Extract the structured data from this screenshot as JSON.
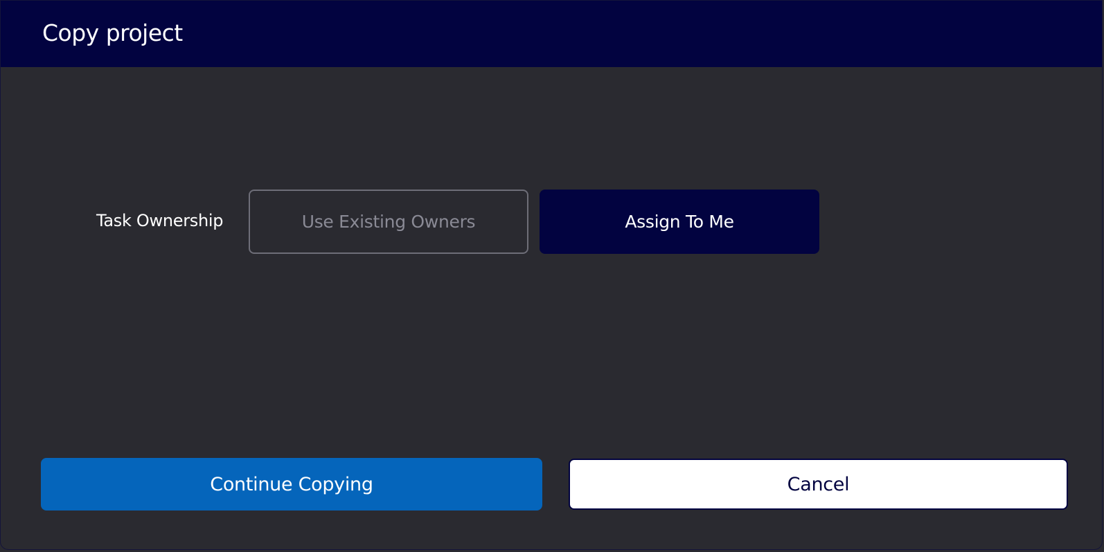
{
  "dialog": {
    "title": "Copy project"
  },
  "task_ownership": {
    "label": "Task Ownership",
    "options": [
      {
        "label": "Use Existing Owners",
        "selected": false
      },
      {
        "label": "Assign To Me",
        "selected": true
      }
    ]
  },
  "actions": {
    "continue_label": "Continue Copying",
    "cancel_label": "Cancel"
  },
  "colors": {
    "header_bg": "#020340",
    "body_bg": "#2a2a30",
    "primary_button": "#0565bb",
    "selected_option": "#020340"
  }
}
